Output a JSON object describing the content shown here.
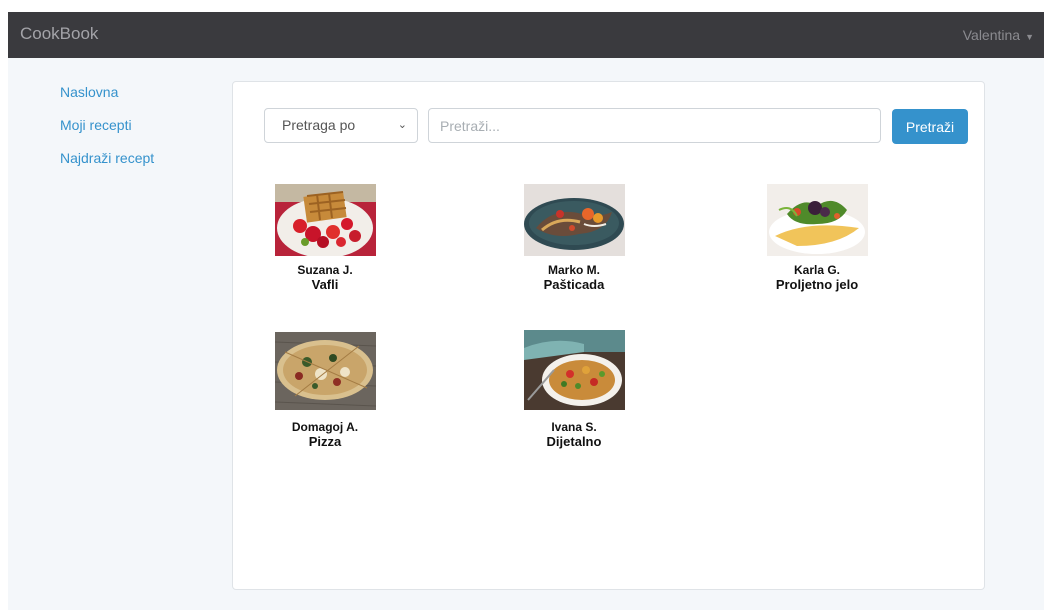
{
  "app": {
    "brand": "CookBook",
    "user": "Valentina"
  },
  "sidebar": {
    "items": [
      {
        "label": "Naslovna"
      },
      {
        "label": "Moji recepti"
      },
      {
        "label": "Najdraži recept"
      }
    ]
  },
  "search": {
    "filter_label": "Pretraga po",
    "placeholder": "Pretraži...",
    "button_label": "Pretraži"
  },
  "recipes": [
    {
      "author": "Suzana J.",
      "name": "Vafli",
      "image": "waffles-photo"
    },
    {
      "author": "Marko M.",
      "name": "Pašticada",
      "image": "grilled-dish-photo"
    },
    {
      "author": "Karla G.",
      "name": "Proljetno jelo",
      "image": "spring-plate-photo"
    },
    {
      "author": "Domagoj A.",
      "name": "Pizza",
      "image": "pizza-photo"
    },
    {
      "author": "Ivana S.",
      "name": "Dijetalno",
      "image": "pasta-salad-photo"
    }
  ],
  "colors": {
    "navbar": "#3a3a3e",
    "accent": "#3592cc",
    "page_bg": "#f4f7fa"
  }
}
